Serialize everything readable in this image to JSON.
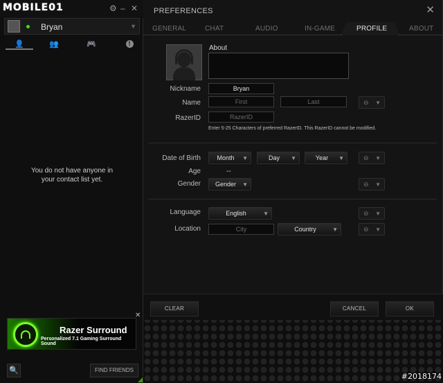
{
  "brand": {
    "logo_text": "MOBILE01",
    "accent_color": "#3ce400"
  },
  "left": {
    "user": {
      "name": "Bryan",
      "status_color": "#3ce400"
    },
    "tabs": [
      {
        "icon": "person-icon"
      },
      {
        "icon": "group-icon"
      },
      {
        "icon": "gamepad-icon"
      },
      {
        "icon": "info-icon"
      }
    ],
    "empty_line1": "You do not have anyone in",
    "empty_line2": "your contact list yet.",
    "ad": {
      "title": "Razer Surround",
      "subtitle": "Personalized 7.1 Gaming Surround Sound"
    },
    "find_friends": "FIND FRIENDS"
  },
  "dialog": {
    "title": "PREFERENCES",
    "close": "✕",
    "tabs": [
      "GENERAL",
      "CHAT",
      "AUDIO",
      "IN-GAME",
      "PROFILE",
      "ABOUT"
    ],
    "active_tab": "PROFILE",
    "about_label": "About",
    "nickname": {
      "label": "Nickname",
      "value": "Bryan"
    },
    "name": {
      "label": "Name",
      "first_placeholder": "First",
      "last_placeholder": "Last"
    },
    "razerid": {
      "label": "RazerID",
      "placeholder": "RazerID",
      "hint": "Enter 5-25 Characters of preferred RazerID. This RazerID cannot be modified."
    },
    "dob": {
      "label": "Date of Birth",
      "month": "Month",
      "day": "Day",
      "year": "Year"
    },
    "age": {
      "label": "Age",
      "value": "--"
    },
    "gender": {
      "label": "Gender",
      "value": "Gender"
    },
    "language": {
      "label": "Language",
      "value": "English"
    },
    "location": {
      "label": "Location",
      "city_placeholder": "City",
      "country": "Country"
    },
    "buttons": {
      "clear": "CLEAR",
      "cancel": "CANCEL",
      "ok": "OK"
    }
  },
  "watermark": "#2018174"
}
